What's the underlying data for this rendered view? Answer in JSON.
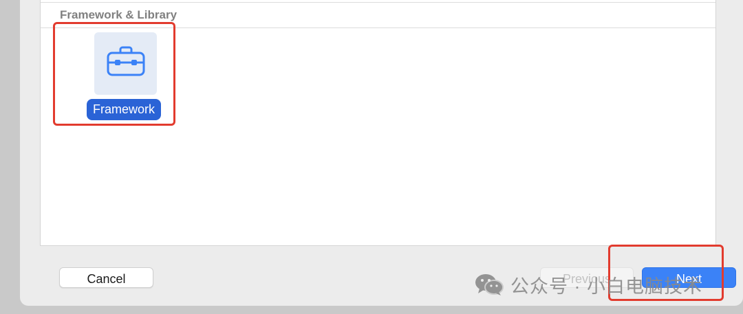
{
  "section": {
    "title": "Framework & Library"
  },
  "template": {
    "label": "Framework",
    "icon": "toolbox-icon",
    "selected": true
  },
  "buttons": {
    "cancel": "Cancel",
    "previous": "Previous",
    "next": "Next"
  },
  "watermark": {
    "icon": "wechat-icon",
    "text": "公众号 · 小白电脑技术"
  },
  "colors": {
    "accent": "#3b82f7",
    "selection": "#2a63d6",
    "highlight": "#e23b2e"
  }
}
